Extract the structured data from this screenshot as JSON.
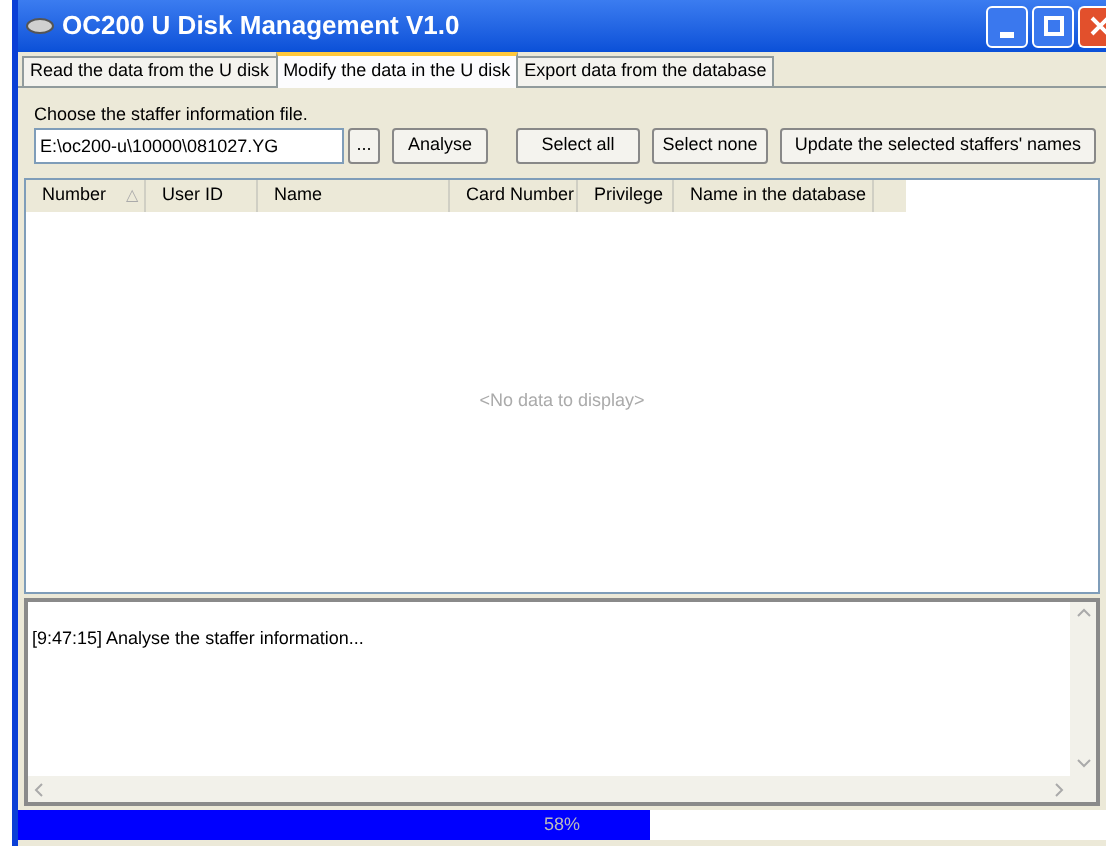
{
  "window": {
    "title": "OC200 U Disk Management V1.0"
  },
  "tabs": [
    {
      "label": "Read the data from the U disk",
      "selected": false
    },
    {
      "label": "Modify the data in the U disk",
      "selected": true
    },
    {
      "label": "Export data from the database",
      "selected": false
    }
  ],
  "file_label": "Choose the staffer information file.",
  "file_field": {
    "value": "E:\\oc200-u\\10000\\081027.YG"
  },
  "browse_button": "...",
  "buttons": [
    "Analyse",
    "Select all",
    "Select none",
    "Update the selected staffers' names"
  ],
  "table": {
    "columns": [
      {
        "label": "Number",
        "sort_mark": "△"
      },
      {
        "label": "User ID"
      },
      {
        "label": "Name"
      },
      {
        "label": "Card Number"
      },
      {
        "label": "Privilege"
      },
      {
        "label": "Name in the database"
      }
    ],
    "empty_text": "<No data to display>"
  },
  "log": {
    "lines": [
      "[9:47:15] Analyse the staffer information..."
    ]
  },
  "progress": {
    "level": 0.58,
    "reading": "58%"
  }
}
